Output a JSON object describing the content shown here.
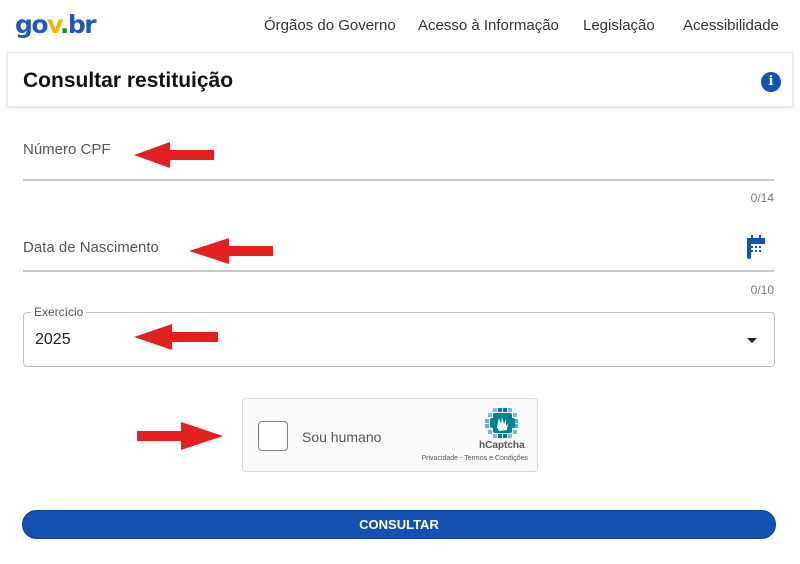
{
  "header": {
    "logo": {
      "part1": "go",
      "part2": "v",
      "part3": ".",
      "part4": "br"
    },
    "nav": [
      {
        "label": "Órgãos do Governo"
      },
      {
        "label": "Acesso à Informação"
      },
      {
        "label": "Legislação"
      },
      {
        "label": "Acessibilidade"
      }
    ]
  },
  "page": {
    "title": "Consultar restituição",
    "info_icon": "info-icon"
  },
  "form": {
    "cpf": {
      "label": "Número CPF",
      "value": "",
      "counter": "0/14",
      "icon": "keyboard-icon"
    },
    "birthdate": {
      "label": "Data de Nascimento",
      "value": "",
      "counter": "0/10",
      "icon": "calendar-icon"
    },
    "exercicio": {
      "legend": "Exercício",
      "selected": "2025",
      "icon": "chevron-down-icon"
    },
    "submit_label": "CONSULTAR"
  },
  "captcha": {
    "label": "Sou humano",
    "brand": "hCaptcha",
    "privacy_label": "Privacidade",
    "separator": " - ",
    "terms_label": "Termos e Condições",
    "checked": false
  },
  "annotations": {
    "arrow_color": "#e32020",
    "count": 4
  },
  "colors": {
    "primary": "#1351b4",
    "logo_blue": "#1f5bb5",
    "logo_yellow": "#f4b400",
    "logo_green": "#1e8a3c"
  }
}
